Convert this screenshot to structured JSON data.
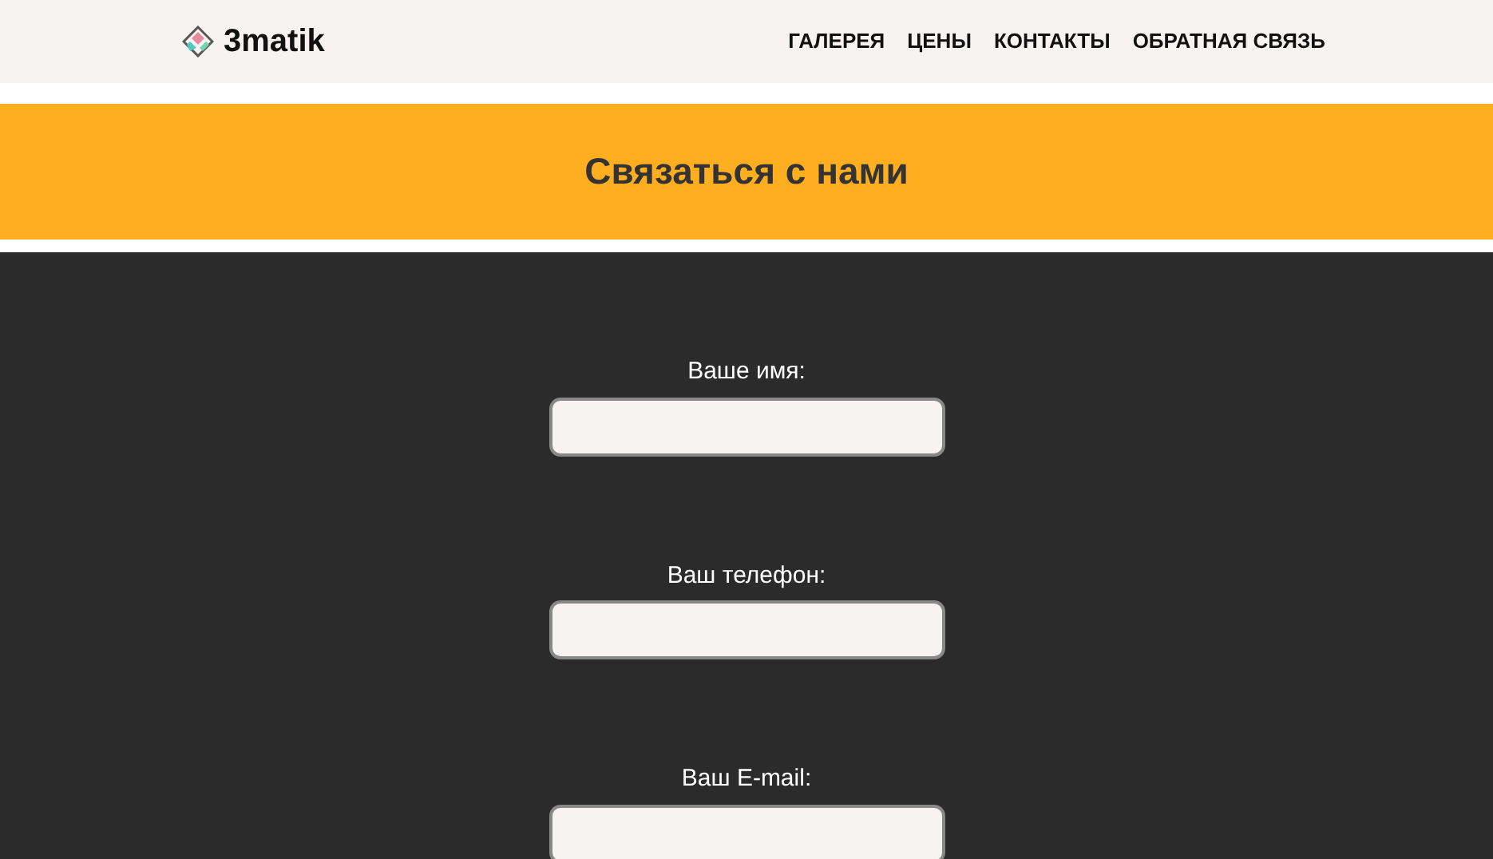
{
  "logo": {
    "text": "3matik"
  },
  "nav": [
    "ГАЛЕРЕЯ",
    "ЦЕНЫ",
    "КОНТАКТЫ",
    "ОБРАТНАЯ СВЯЗЬ"
  ],
  "banner": {
    "title": "Связаться с нами"
  },
  "form": {
    "fields": [
      {
        "label": "Ваше имя:"
      },
      {
        "label": "Ваш телефон:"
      },
      {
        "label": "Ваш E-mail:"
      }
    ]
  }
}
